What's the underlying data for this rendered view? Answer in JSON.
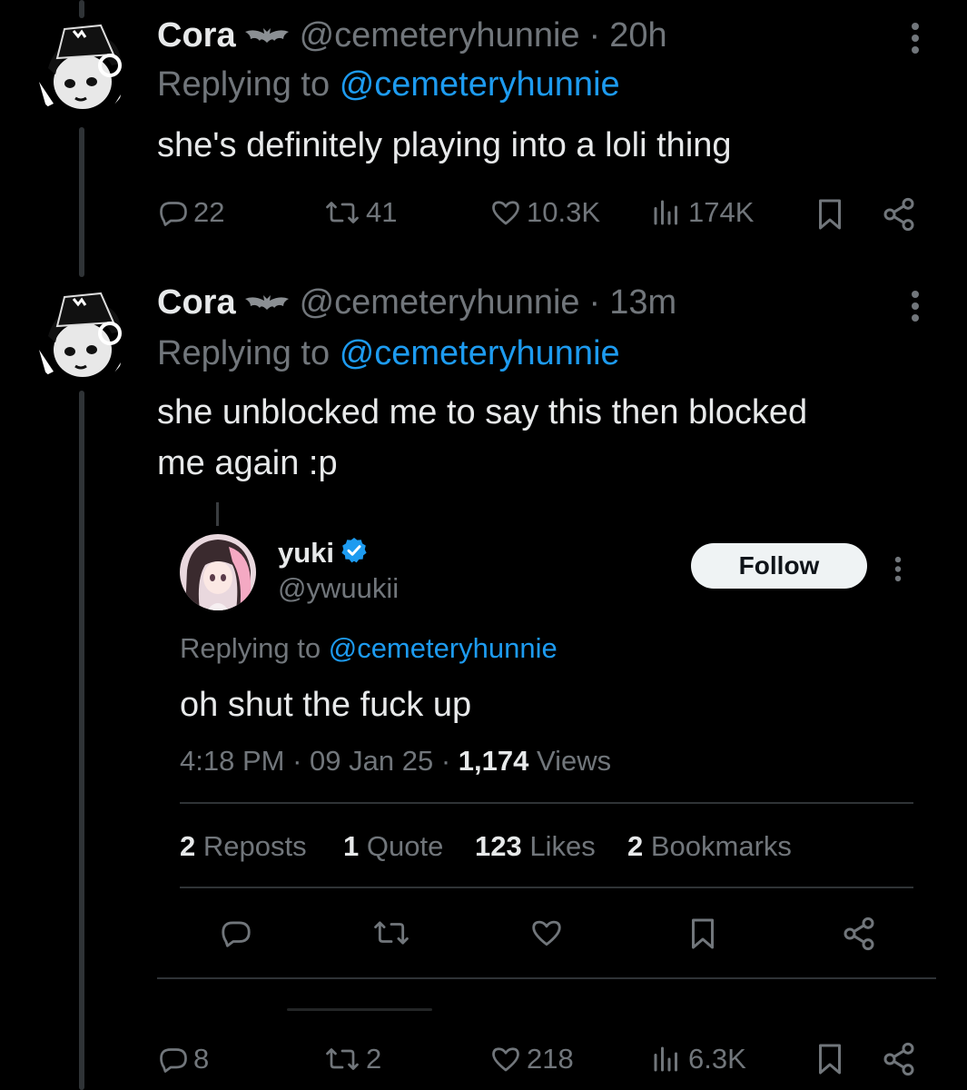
{
  "tweets": [
    {
      "name": "Cora",
      "handle": "@cemeteryhunnie",
      "time": "20h",
      "replying_prefix": "Replying to",
      "replying_to": "@cemeteryhunnie",
      "text": "she's definitely playing into a loli thing",
      "stats": {
        "replies": "22",
        "reposts": "41",
        "likes": "10.3K",
        "views": "174K"
      }
    },
    {
      "name": "Cora",
      "handle": "@cemeteryhunnie",
      "time": "13m",
      "replying_prefix": "Replying to",
      "replying_to": "@cemeteryhunnie",
      "text_line1": "she unblocked me to say this then blocked",
      "text_line2": "me again :p",
      "stats": {
        "replies": "8",
        "reposts": "2",
        "likes": "218",
        "views": "6.3K"
      }
    }
  ],
  "quoted": {
    "name": "yuki",
    "handle": "@ywuukii",
    "follow_label": "Follow",
    "replying_prefix": "Replying to",
    "replying_to": "@cemeteryhunnie",
    "text": "oh shut the fuck up",
    "time": "4:18 PM",
    "date": "09 Jan 25",
    "views_count": "1,174",
    "views_label": "Views",
    "reposts_count": "2",
    "reposts_label": "Reposts",
    "quotes_count": "1",
    "quotes_label": "Quote",
    "likes_count": "123",
    "likes_label": "Likes",
    "bookmarks_count": "2",
    "bookmarks_label": "Bookmarks"
  },
  "separator": "·",
  "colors": {
    "background": "#000000",
    "text": "#e7e9ea",
    "muted": "#71767b",
    "link": "#1d9bf0",
    "verified": "#1d9bf0",
    "divider": "#2f3336"
  },
  "icons": [
    "bat-icon",
    "more-icon",
    "reply-icon",
    "repost-icon",
    "like-icon",
    "views-icon",
    "bookmark-icon",
    "share-icon",
    "verified-icon"
  ]
}
